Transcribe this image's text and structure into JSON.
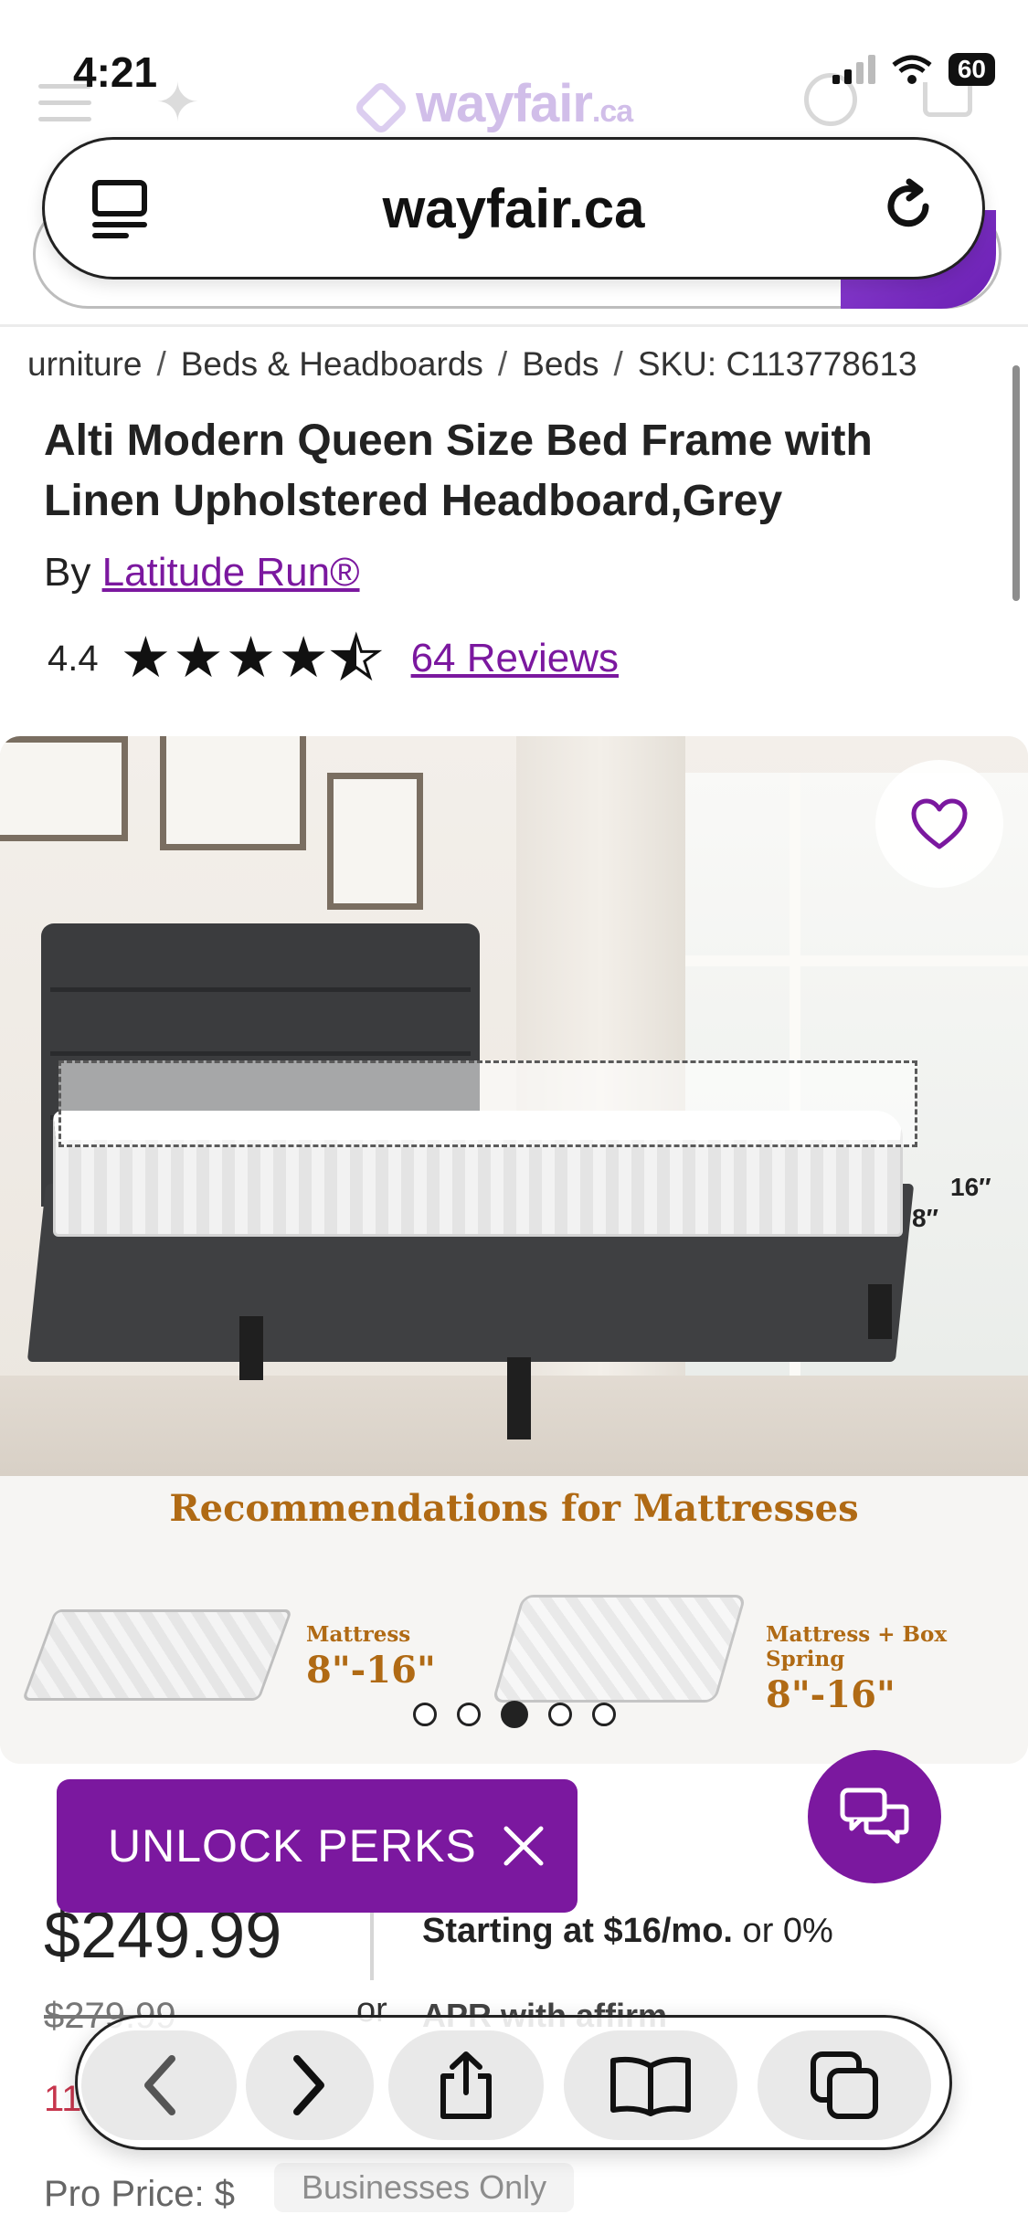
{
  "status_bar": {
    "time": "4:21",
    "battery": "60"
  },
  "site_header": {
    "logo_text": "wayfair",
    "logo_suffix": ".ca"
  },
  "browser": {
    "url": "wayfair.ca"
  },
  "breadcrumb": [
    "urniture",
    "Beds & Headboards",
    "Beds",
    "SKU: C113778613"
  ],
  "product": {
    "title": "Alti Modern Queen Size Bed Frame with Linen Upholstered Headboard,Grey",
    "by_label": "By",
    "brand": "Latitude Run®",
    "rating": 4.4,
    "rating_text": "4.4",
    "reviews_link": "64 Reviews"
  },
  "gallery": {
    "image_dims": {
      "height_total": "16′′",
      "height_mattress": "8′′"
    },
    "recommendations_title": "Recommendations for Mattresses",
    "options": [
      {
        "label": "Mattress",
        "range": "8\"-16\""
      },
      {
        "label": "Mattress + Box Spring",
        "range": "8\"-16\""
      }
    ],
    "carousel_active_index": 2,
    "carousel_count": 5
  },
  "promo": {
    "unlock_perks": "UNLOCK PERKS"
  },
  "pricing": {
    "price": "$249.99",
    "financing_prefix": "Starting at ",
    "financing_amount": "$16/mo.",
    "financing_suffix": " or 0%",
    "was_price": "$279.99",
    "or_label": "or",
    "apr_text": "APR with affirm",
    "sale_text": "11",
    "pro_price_label": "Pro Price: $",
    "pro_badge": "Businesses Only"
  },
  "colors": {
    "brand_purple": "#7b189f",
    "reco_gold": "#b06a14"
  }
}
